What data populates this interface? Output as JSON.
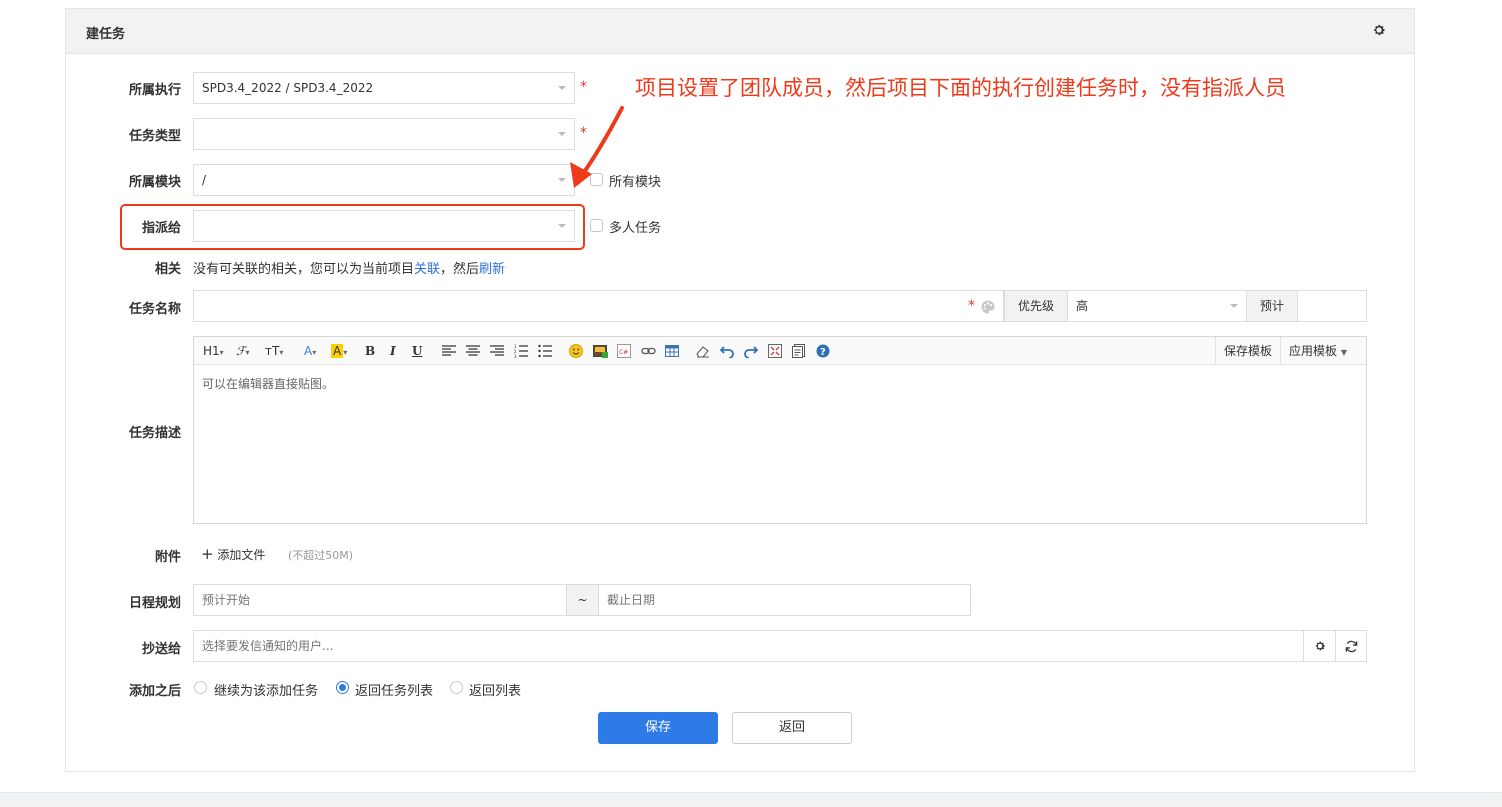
{
  "panel": {
    "title": "建任务"
  },
  "fields": {
    "execution": {
      "label": "所属执行",
      "value": "SPD3.4_2022 / SPD3.4_2022",
      "required": "*"
    },
    "task_type": {
      "label": "任务类型",
      "value": "",
      "required": "*"
    },
    "module": {
      "label": "所属模块",
      "value": "/",
      "checkbox_label": "所有模块"
    },
    "assign_to": {
      "label": "指派给",
      "value": "",
      "checkbox_label": "多人任务"
    },
    "related": {
      "label": "相关",
      "text_before": "没有可关联的相关，您可以为当前项目",
      "link1": "关联",
      "text_middle": "，然后",
      "link2": "刷新"
    },
    "task_name": {
      "label": "任务名称",
      "value": "",
      "required": "*",
      "priority_label": "优先级",
      "priority_value": "高",
      "estimate_label": "预计",
      "estimate_value": ""
    },
    "description": {
      "label": "任务描述",
      "placeholder": "可以在编辑器直接贴图。",
      "save_template": "保存模板",
      "apply_template": "应用模板"
    },
    "attachment": {
      "label": "附件",
      "add_file": "添加文件",
      "limit": "(不超过50M)"
    },
    "schedule": {
      "label": "日程规划",
      "start_placeholder": "预计开始",
      "separator": "~",
      "end_placeholder": "截止日期"
    },
    "cc": {
      "label": "抄送给",
      "placeholder": "选择要发信通知的用户..."
    },
    "after_add": {
      "label": "添加之后",
      "options": [
        "继续为该添加任务",
        "返回任务列表",
        "返回列表"
      ],
      "selected": "返回任务列表"
    }
  },
  "toolbar": {
    "heading": "H1",
    "font_family": "ℱ",
    "font_size": "тT",
    "font_color": "A",
    "bg_color": "A",
    "bold": "B",
    "italic": "I",
    "underline": "U"
  },
  "buttons": {
    "save": "保存",
    "back": "返回"
  },
  "annotation": {
    "text": "项目设置了团队成员，然后项目下面的执行创建任务时，没有指派人员"
  },
  "colors": {
    "primary": "#2e7ae6",
    "annotation": "#ee3a1b",
    "required": "#ee3333",
    "link": "#2f6fd7"
  }
}
